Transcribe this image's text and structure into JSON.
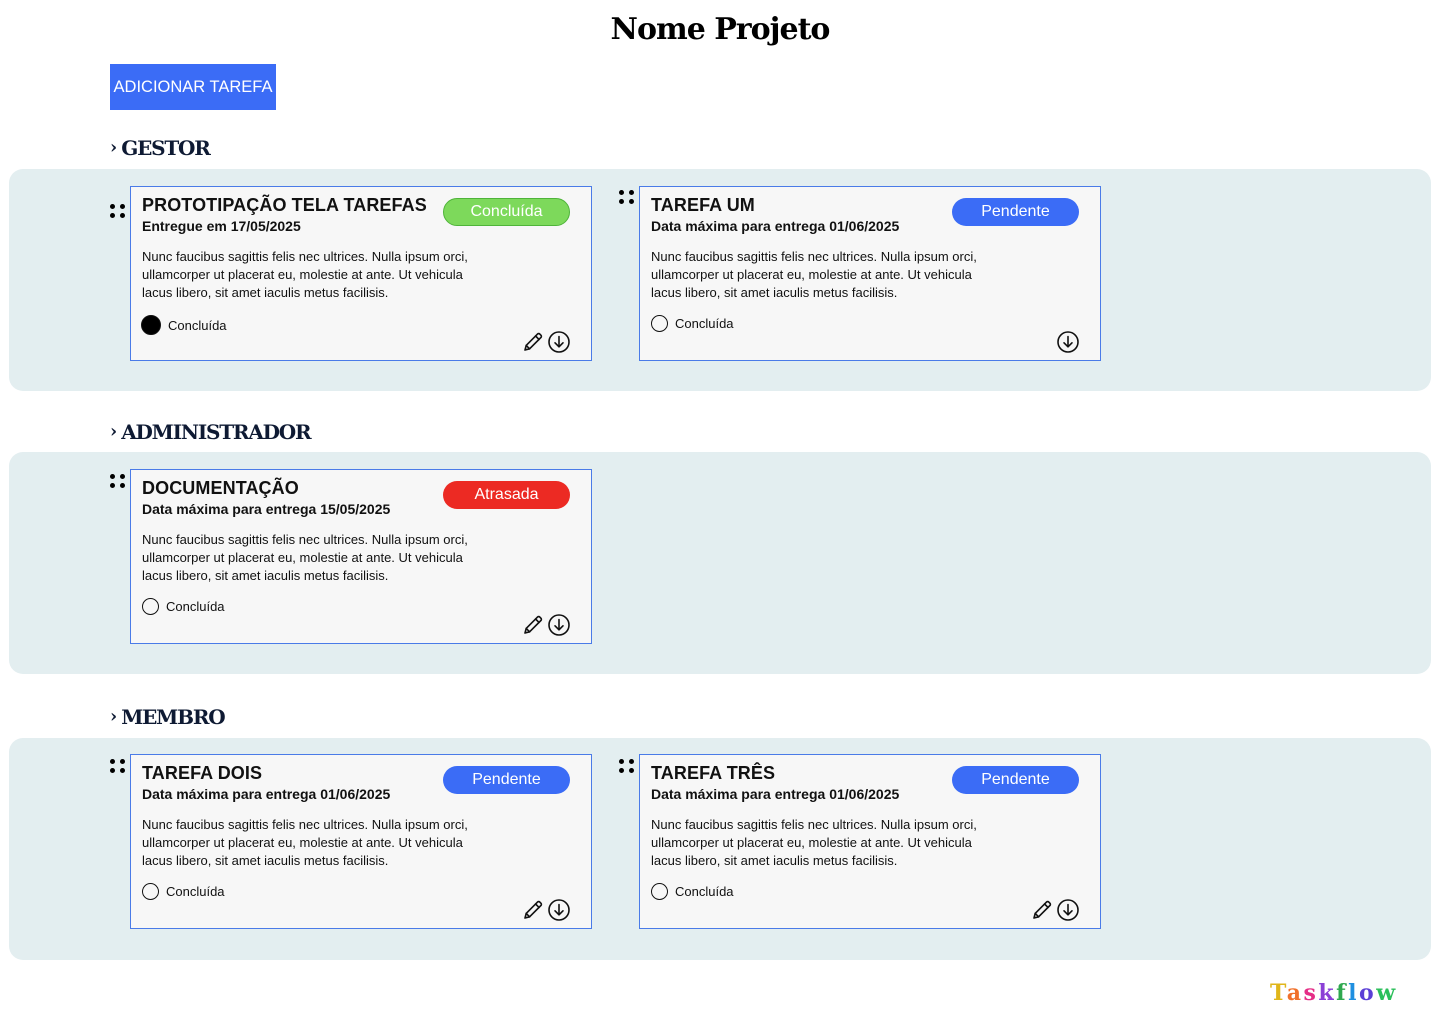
{
  "page_title": "Nome Projeto",
  "add_task_button": "ADICIONAR TAREFA",
  "colors": {
    "primary": "#3b6cf6",
    "section_background": "#e3eef0",
    "card_border": "#4a7be8",
    "status_concluida": "#7dd95b",
    "status_pendente": "#3b6cf6",
    "status_atrasada": "#ec2a23"
  },
  "sections": [
    {
      "heading": "GESTOR",
      "cards": [
        {
          "title": "PROTOTIPAÇÃO TELA TAREFAS",
          "date": "Entregue em 17/05/2025",
          "status": "Concluída",
          "description": "Nunc faucibus sagittis felis nec ultrices. Nulla ipsum orci, ullamcorper ut placerat eu, molestie at ante. Ut vehicula lacus libero, sit amet iaculis metus facilisis.",
          "done_label": "Concluída",
          "done": true,
          "icons": [
            "pencil-icon",
            "download-icon"
          ]
        },
        {
          "title": "TAREFA UM",
          "date": "Data máxima para entrega 01/06/2025",
          "status": "Pendente",
          "description": "Nunc faucibus sagittis felis nec ultrices. Nulla ipsum orci, ullamcorper ut placerat eu, molestie at ante. Ut vehicula lacus libero, sit amet iaculis metus facilisis.",
          "done_label": "Concluída",
          "done": false,
          "icons": [
            "download-icon"
          ]
        }
      ]
    },
    {
      "heading": "ADMINISTRADOR",
      "cards": [
        {
          "title": "DOCUMENTAÇÃO",
          "date": "Data máxima para entrega 15/05/2025",
          "status": "Atrasada",
          "description": "Nunc faucibus sagittis felis nec ultrices. Nulla ipsum orci, ullamcorper ut placerat eu, molestie at ante. Ut vehicula lacus libero, sit amet iaculis metus facilisis.",
          "done_label": "Concluída",
          "done": false,
          "icons": [
            "pencil-icon",
            "download-icon"
          ]
        }
      ]
    },
    {
      "heading": "MEMBRO",
      "cards": [
        {
          "title": "TAREFA DOIS",
          "date": "Data máxima para entrega 01/06/2025",
          "status": "Pendente",
          "description": "Nunc faucibus sagittis felis nec ultrices. Nulla ipsum orci, ullamcorper ut placerat eu, molestie at ante. Ut vehicula lacus libero, sit amet iaculis metus facilisis.",
          "done_label": "Concluída",
          "done": false,
          "icons": [
            "pencil-icon",
            "download-icon"
          ]
        },
        {
          "title": "TAREFA TRÊS",
          "date": "Data máxima para entrega 01/06/2025",
          "status": "Pendente",
          "description": "Nunc faucibus sagittis felis nec ultrices. Nulla ipsum orci, ullamcorper ut placerat eu, molestie at ante. Ut vehicula lacus libero, sit amet iaculis metus facilisis.",
          "done_label": "Concluída",
          "done": false,
          "icons": [
            "pencil-icon",
            "download-icon"
          ]
        }
      ]
    }
  ],
  "brand": {
    "text": "Taskflow",
    "letter_colors": [
      "#e0b61b",
      "#f0702a",
      "#e52e87",
      "#8b3fd6",
      "#2fa84f",
      "#1f8fe0",
      "#5b3fd6",
      "#2bbf5a"
    ]
  }
}
